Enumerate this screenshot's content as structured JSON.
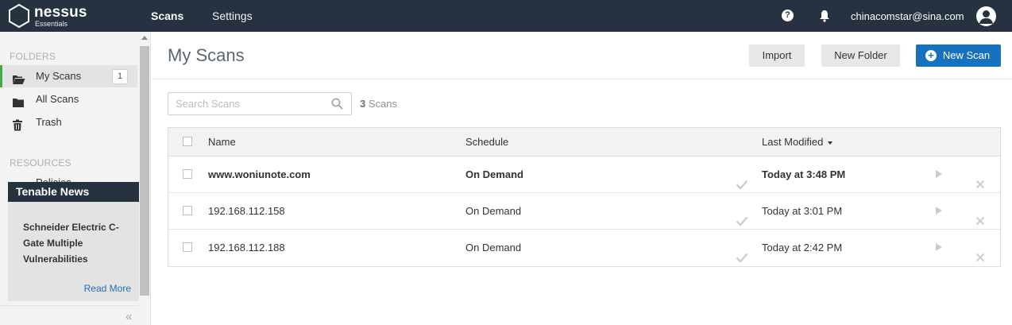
{
  "app": {
    "brand": "nessus",
    "edition": "Essentials"
  },
  "topnav": {
    "scans_label": "Scans",
    "settings_label": "Settings",
    "help_label": "?",
    "username": "chinacomstar@sina.com"
  },
  "sidebar": {
    "folders_heading": "FOLDERS",
    "items": [
      {
        "label": "My Scans",
        "badge": "1",
        "icon": "folder-open-icon",
        "active": true
      },
      {
        "label": "All Scans",
        "icon": "folder-icon"
      },
      {
        "label": "Trash",
        "icon": "trash-icon"
      }
    ],
    "resources_heading": "RESOURCES",
    "policies_peek": "Policies"
  },
  "news": {
    "title": "Tenable News",
    "headline": "Schneider Electric C-Gate Multiple Vulnerabilities",
    "read_more": "Read More"
  },
  "main": {
    "title": "My Scans",
    "import_label": "Import",
    "new_folder_label": "New Folder",
    "new_scan_label": "New Scan",
    "search_placeholder": "Search Scans",
    "scan_count": "3",
    "scan_count_suffix": "Scans"
  },
  "table": {
    "headers": {
      "name": "Name",
      "schedule": "Schedule",
      "last_modified": "Last Modified"
    },
    "rows": [
      {
        "name": "www.woniunote.com",
        "schedule": "On Demand",
        "last_modified": "Today at 3:48 PM",
        "unread": true
      },
      {
        "name": "192.168.112.158",
        "schedule": "On Demand",
        "last_modified": "Today at 3:01 PM",
        "unread": false
      },
      {
        "name": "192.168.112.188",
        "schedule": "On Demand",
        "last_modified": "Today at 2:42 PM",
        "unread": false
      }
    ]
  },
  "colors": {
    "topbar": "#26323f",
    "accent_green": "#3fae49",
    "primary_blue": "#1672bf",
    "link_blue": "#1e6fb8"
  }
}
